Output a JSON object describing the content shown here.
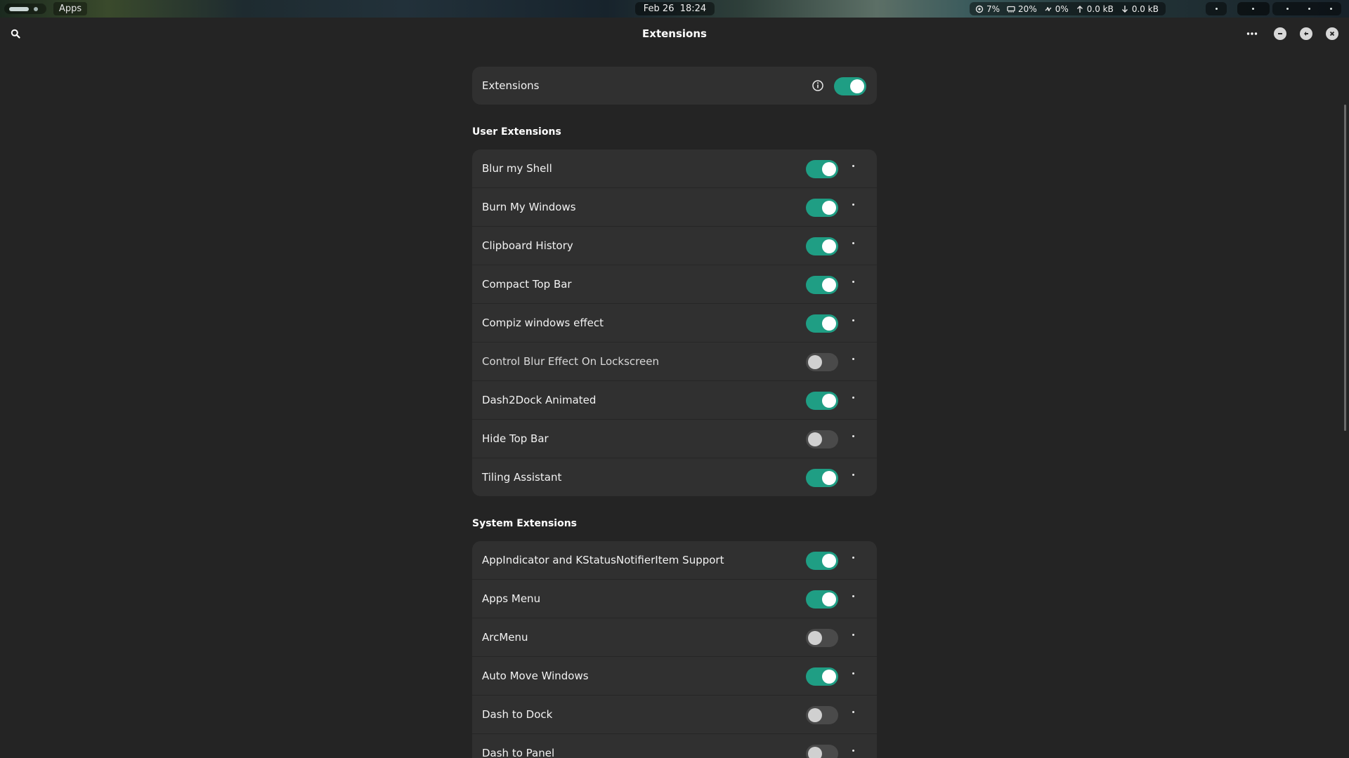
{
  "topbar": {
    "apps_label": "Apps",
    "clock": "Feb 26  18:24",
    "indicators": [
      {
        "icon": "cpu-icon",
        "value": "7%"
      },
      {
        "icon": "memory-icon",
        "value": "20%"
      },
      {
        "icon": "swap-icon",
        "value": "0%"
      },
      {
        "icon": "upload-arrow-icon",
        "value": "0.0 kB"
      },
      {
        "icon": "download-arrow-icon",
        "value": "0.0 kB"
      }
    ]
  },
  "header": {
    "title": "Extensions"
  },
  "main": {
    "label": "Extensions",
    "enabled": true
  },
  "user_section": {
    "title": "User Extensions",
    "items": [
      {
        "label": "Blur my Shell",
        "enabled": true
      },
      {
        "label": "Burn My Windows",
        "enabled": true
      },
      {
        "label": "Clipboard History",
        "enabled": true
      },
      {
        "label": "Compact Top Bar",
        "enabled": true
      },
      {
        "label": "Compiz windows effect",
        "enabled": true
      },
      {
        "label": "Control Blur Effect On Lockscreen",
        "enabled": false,
        "dimmed": true
      },
      {
        "label": "Dash2Dock Animated",
        "enabled": true
      },
      {
        "label": "Hide Top Bar",
        "enabled": false
      },
      {
        "label": "Tiling Assistant",
        "enabled": true
      }
    ]
  },
  "system_section": {
    "title": "System Extensions",
    "items": [
      {
        "label": "AppIndicator and KStatusNotifierItem Support",
        "enabled": true
      },
      {
        "label": "Apps Menu",
        "enabled": true
      },
      {
        "label": "ArcMenu",
        "enabled": false
      },
      {
        "label": "Auto Move Windows",
        "enabled": true
      },
      {
        "label": "Dash to Dock",
        "enabled": false
      },
      {
        "label": "Dash to Panel",
        "enabled": false
      }
    ]
  },
  "colors": {
    "accent": "#1f9e84",
    "background": "#242424",
    "card": "#303030"
  }
}
